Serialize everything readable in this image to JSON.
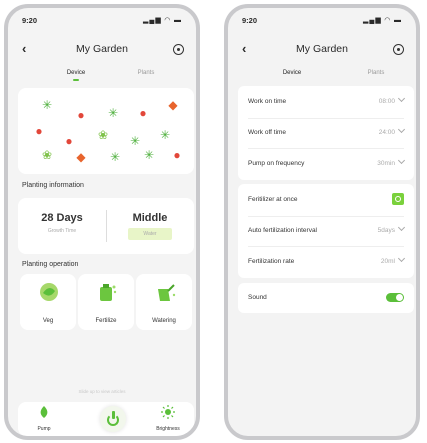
{
  "left_screen": {
    "status": {
      "time": "9:20",
      "signal": "▂▄▆ ◠ ▬"
    },
    "nav": {
      "back_symbol": "‹",
      "title": "My Garden"
    },
    "tabs": [
      "Device",
      "Plants"
    ],
    "plant_icons": [
      "herb",
      "tomato",
      "herb",
      "tomato",
      "pepper",
      "tomato",
      "tomato",
      "lettuce",
      "herb",
      "herb",
      "lettuce",
      "pepper",
      "herb",
      "herb",
      "tomato"
    ],
    "planting_information": {
      "title": "Planting information",
      "growth_value": "28 Days",
      "growth_label": "Growth Time",
      "water_value": "Middle",
      "water_label": "Water"
    },
    "planting_operation": {
      "title": "Planting operation",
      "items": [
        {
          "label": "Veg",
          "icon": "lettuce-icon"
        },
        {
          "label": "Fertilize",
          "icon": "fertilize-icon"
        },
        {
          "label": "Watering",
          "icon": "watering-can-icon"
        }
      ]
    },
    "hint": "Slide up to view articles",
    "bottom_bar": {
      "pump_label": "Pump",
      "brightness_label": "Brightness"
    }
  },
  "right_screen": {
    "status": {
      "time": "9:20",
      "signal": "▂▄▆ ◠ ▬"
    },
    "nav": {
      "back_symbol": "‹",
      "title": "My Garden"
    },
    "tabs": [
      "Device",
      "Plants"
    ],
    "schedule": [
      {
        "key": "Work on time",
        "value": "08:00"
      },
      {
        "key": "Work off time",
        "value": "24:00"
      },
      {
        "key": "Pump on frequency",
        "value": "30min"
      }
    ],
    "fertilizer": [
      {
        "key": "Feritilizer at once",
        "control": "button"
      },
      {
        "key": "Auto fertilization interval",
        "value": "5days"
      },
      {
        "key": "Fertilization rate",
        "value": "20ml"
      }
    ],
    "sound": {
      "key": "Sound",
      "enabled": true
    }
  },
  "colors": {
    "accent": "#5bbf3a",
    "frame": "#c9c9cc",
    "background": "#f4f4f4"
  }
}
